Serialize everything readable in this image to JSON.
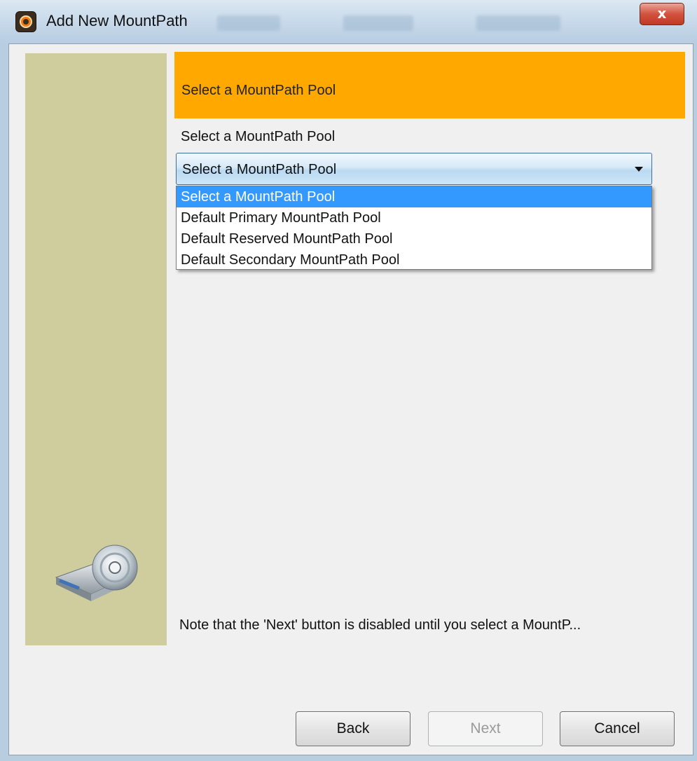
{
  "window": {
    "title": "Add New MountPath",
    "close_glyph": "x"
  },
  "header": {
    "title": "Select a MountPath Pool",
    "color": "#ffa800"
  },
  "form": {
    "label": "Select a MountPath Pool",
    "selected_value": "Select a MountPath Pool",
    "options": [
      "Select a MountPath Pool",
      "Default Primary MountPath Pool",
      "Default Reserved MountPath Pool",
      "Default Secondary MountPath Pool"
    ],
    "highlighted_option_index": 0
  },
  "note": "Note that the 'Next' button is disabled until you select a MountP...",
  "buttons": {
    "back": "Back",
    "next": "Next",
    "cancel": "Cancel"
  },
  "colors": {
    "side_panel": "#cfcd9e",
    "selection": "#3399ff"
  },
  "icons": {
    "app": "app-logo-icon",
    "side": "disk-drive-icon"
  }
}
